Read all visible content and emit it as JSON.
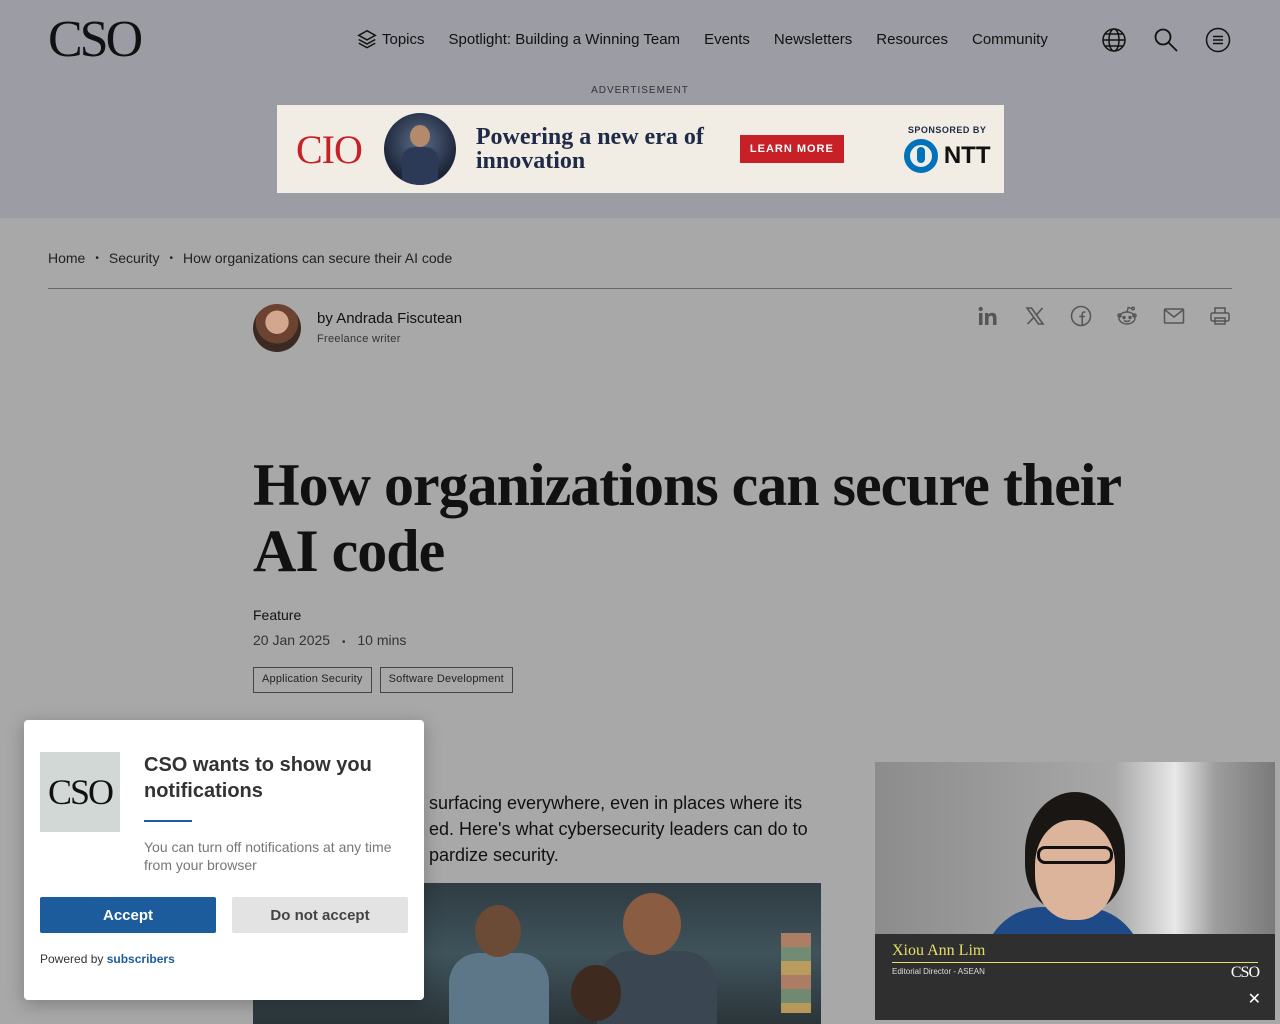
{
  "header": {
    "logo": "CSO",
    "nav": [
      "Topics",
      "Spotlight: Building a Winning Team",
      "Events",
      "Newsletters",
      "Resources",
      "Community"
    ],
    "icons": [
      "globe-icon",
      "search-icon",
      "menu-icon"
    ]
  },
  "ad": {
    "label": "ADVERTISEMENT",
    "brand": "CIO",
    "headline": "Powering a new era of innovation",
    "cta": "LEARN MORE",
    "sponsor_label": "SPONSORED BY",
    "sponsor": "NTT"
  },
  "breadcrumb": [
    "Home",
    "Security",
    "How organizations can secure their AI code"
  ],
  "author": {
    "by": "by",
    "name": "Andrada Fiscutean",
    "role": "Freelance writer"
  },
  "share_icons": [
    "linkedin-icon",
    "x-icon",
    "facebook-icon",
    "reddit-icon",
    "email-icon",
    "print-icon"
  ],
  "article": {
    "title": "How organizations can secure their AI code",
    "kicker": "Feature",
    "date": "20 Jan 2025",
    "read_time": "10 mins",
    "tags": [
      "Application Security",
      "Software Development"
    ],
    "dek_visible": "surfacing everywhere, even in places where its\ned. Here's what cybersecurity leaders can do to\npardize security."
  },
  "notification": {
    "logo": "CSO",
    "title": "CSO wants to show you notifications",
    "body": "You can turn off notifications at any time from your browser",
    "accept": "Accept",
    "deny": "Do not accept",
    "powered_prefix": "Powered by",
    "powered_link": "subscribers",
    "accent_color": "#1d5c9c"
  },
  "video": {
    "name": "Xiou Ann Lim",
    "role": "Editorial Director - ASEAN",
    "logo": "CSO",
    "close": "✕"
  }
}
